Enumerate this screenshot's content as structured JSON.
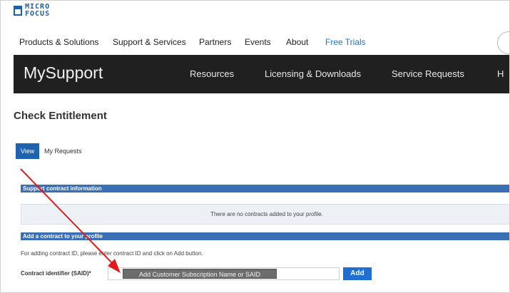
{
  "logo": {
    "line1": "MICRO",
    "line2": "FOCUS"
  },
  "topnav": {
    "items": [
      "Products & Solutions",
      "Support & Services",
      "Partners",
      "Events",
      "About"
    ],
    "trial": "Free Trials"
  },
  "header": {
    "brand": "MySupport",
    "nav": [
      "Resources",
      "Licensing & Downloads",
      "Service Requests",
      "H"
    ]
  },
  "page": {
    "title": "Check Entitlement"
  },
  "tabs": {
    "view": "View",
    "requests": "My Requests"
  },
  "support_section": {
    "heading": "Support contract information",
    "message": "There are no contracts added to your profile."
  },
  "add_section": {
    "heading": "Add a contract to your profile",
    "help": "For adding contract ID, please enter contract ID and click on Add button.",
    "label": "Contract identifier (SAID)*",
    "input_value": "",
    "overlay": "Add Customer Subscription Name or SAID",
    "button": "Add"
  },
  "colors": {
    "brand_blue": "#1f63b0",
    "section_blue": "#3a6fb6",
    "dark_bar": "#202020",
    "arrow": "#e01b1b",
    "trial_link": "#1f77c9"
  }
}
